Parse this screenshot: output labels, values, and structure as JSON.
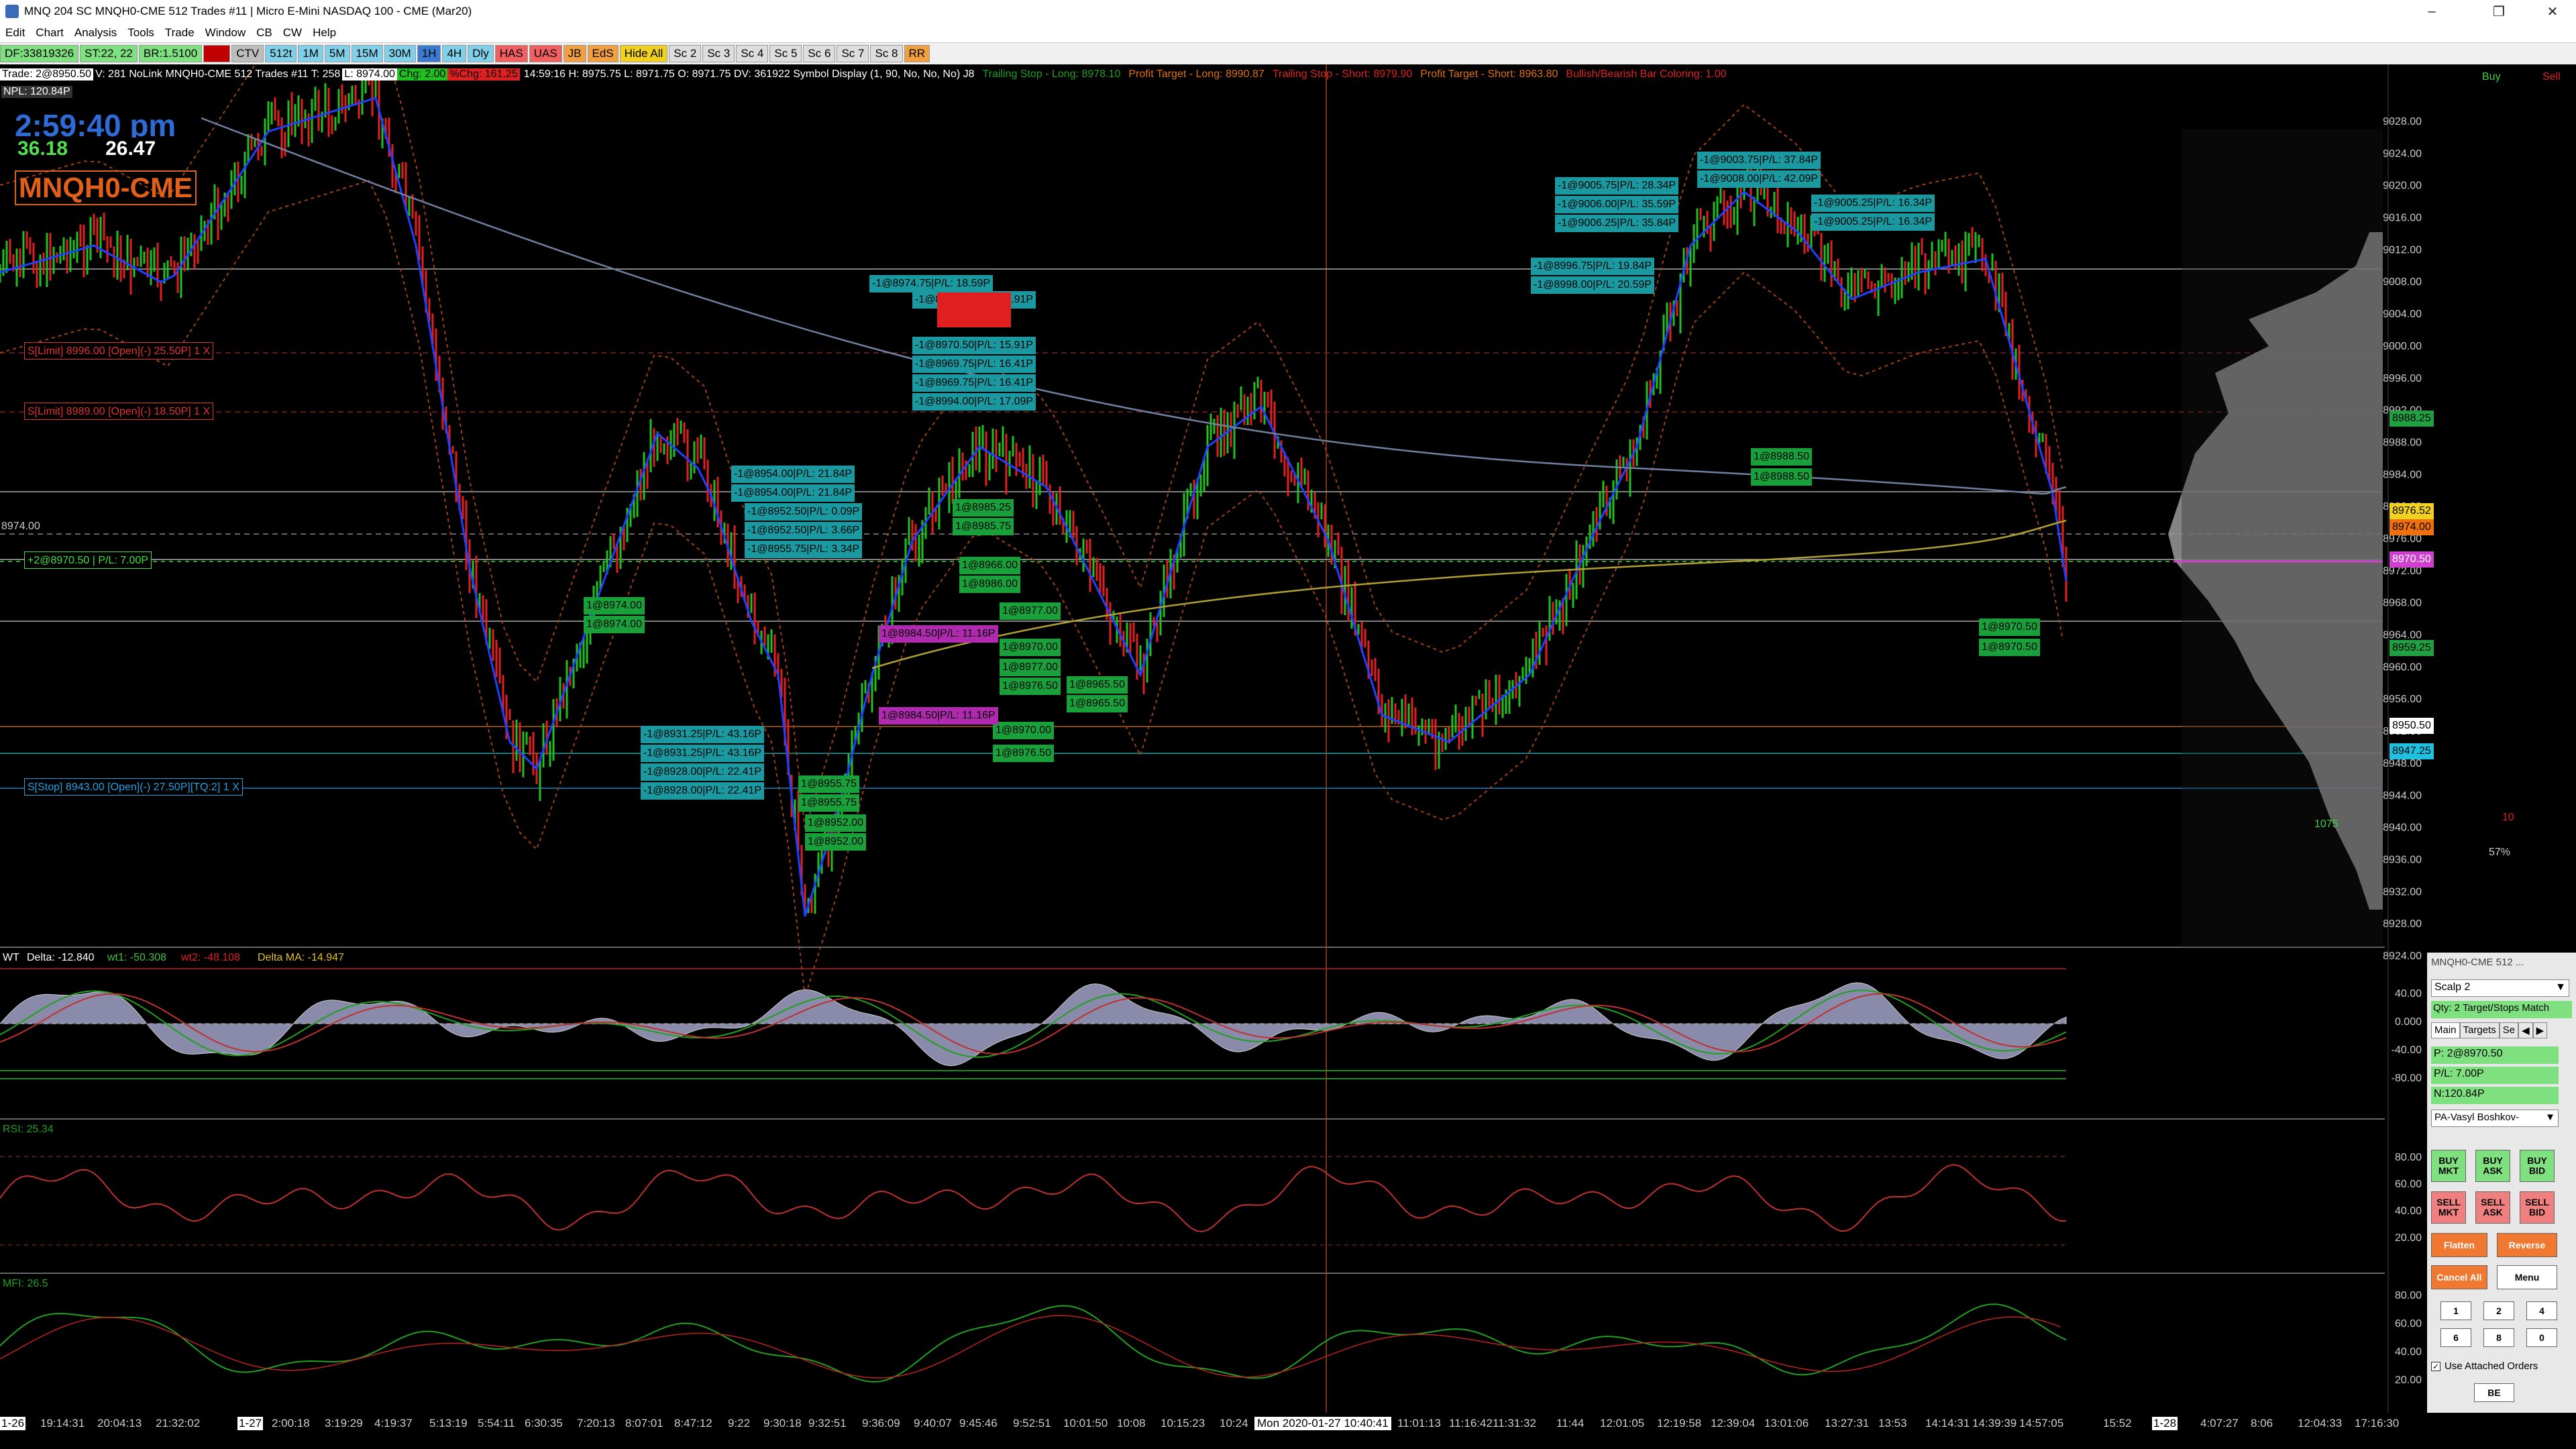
{
  "window": {
    "title": "MNQ 204  SC MNQH0-CME  512 Trades  #11 | Micro E-Mini NASDAQ 100 - CME (Mar20)"
  },
  "menu": [
    "Edit",
    "Chart",
    "Analysis",
    "Tools",
    "Trade",
    "Window",
    "CB",
    "CW",
    "Help"
  ],
  "toolbar": {
    "df": "DF:33819326",
    "st": "ST:22, 22",
    "br": "BR:1.5100",
    "tabs": [
      {
        "label": "CTV",
        "color": "#bdbdbd"
      },
      {
        "label": "512t",
        "color": "#7fd0e8"
      },
      {
        "label": "1M",
        "color": "#7fd0e8"
      },
      {
        "label": "5M",
        "color": "#7fd0e8"
      },
      {
        "label": "15M",
        "color": "#7fd0e8"
      },
      {
        "label": "30M",
        "color": "#7fd0e8"
      },
      {
        "label": "1H",
        "color": "#3a7ad0"
      },
      {
        "label": "4H",
        "color": "#7fd0e8"
      },
      {
        "label": "Dly",
        "color": "#7fd0e8"
      },
      {
        "label": "HAS",
        "color": "#f06060"
      },
      {
        "label": "UAS",
        "color": "#f06060"
      },
      {
        "label": "JB",
        "color": "#f0a040"
      },
      {
        "label": "EdS",
        "color": "#f0a040"
      },
      {
        "label": "Hide All",
        "color": "#f0d020"
      },
      {
        "label": "Sc 2",
        "color": "#ddd"
      },
      {
        "label": "Sc 3",
        "color": "#ddd"
      },
      {
        "label": "Sc 4",
        "color": "#ddd"
      },
      {
        "label": "Sc 5",
        "color": "#ddd"
      },
      {
        "label": "Sc 6",
        "color": "#ddd"
      },
      {
        "label": "Sc 7",
        "color": "#ddd"
      },
      {
        "label": "Sc 8",
        "color": "#ddd"
      },
      {
        "label": "RR",
        "color": "#f0a040"
      }
    ]
  },
  "info": {
    "trade": "Trade: 2@8950.50",
    "main": "V: 281 NoLink MNQH0-CME  512 Trades  #11  T: 258",
    "price": "L: 8974.00",
    "chg": "Chg: 2.00",
    "pct": "%Chg: 161.25",
    "tail": "14:59:16 H: 8975.75 L: 8971.75 O: 8971.75 DV: 361922 Symbol Display  (1, 90, No, No, No)  J8",
    "ts_long": "Trailing Stop - Long: 8978.10",
    "pt_long": "Profit Target - Long: 8990.87",
    "ts_short": "Trailing Stop - Short: 8979.90",
    "pt_short": "Profit Target - Short: 8963.80",
    "bb": "Bullish/Bearish Bar Coloring: 1.00"
  },
  "npl": "NPL: 120.84P",
  "clock": "2:59:40 pm",
  "num1": "36.18",
  "num2": "26.47",
  "symbol": "MNQH0-CME",
  "price_axis": [
    "9028.00",
    "9024.00",
    "9020.00",
    "9016.00",
    "9012.00",
    "9008.00",
    "9004.00",
    "9000.00",
    "8996.00",
    "8992.00",
    "8988.00",
    "8984.00",
    "8980.00",
    "8976.00",
    "8972.00",
    "8968.00",
    "8964.00",
    "8960.00",
    "8956.00",
    "8952.00",
    "8948.00",
    "8944.00",
    "8940.00",
    "8936.00",
    "8932.00",
    "8928.00",
    "8924.00"
  ],
  "price_tags": [
    {
      "text": "8976.52",
      "bg": "#f0d020",
      "fg": "#000"
    },
    {
      "text": "8974.00",
      "bg": "#f07010",
      "fg": "#000"
    },
    {
      "text": "8970.50",
      "bg": "#d040d0",
      "fg": "#fff"
    },
    {
      "text": "8950.50",
      "bg": "#fff",
      "fg": "#000"
    },
    {
      "text": "8947.25",
      "bg": "#20c0e0",
      "fg": "#000"
    },
    {
      "text": "8988.25",
      "bg": "#20a040",
      "fg": "#000"
    },
    {
      "text": "8959.25",
      "bg": "#20a040",
      "fg": "#000"
    }
  ],
  "left_tags": [
    {
      "text": "S[Limit] 8996.00 [Open](-) 25.50P] 1 X",
      "color": "#e03030"
    },
    {
      "text": "S[Limit] 8989.00 [Open](-) 18.50P] 1 X",
      "color": "#e03030"
    },
    {
      "text": "+2@8970.50 | P/L: 7.00P",
      "color": "#40e040"
    },
    {
      "text": "S[Stop] 8943.00 [Open](-) 27.50P][TQ:2] 1 X",
      "color": "#20a0e0"
    }
  ],
  "price_left": "8974.00",
  "order_tags": [
    {
      "text": "-1@8974.75|P/L: 18.59P",
      "kind": "cyan"
    },
    {
      "text": "-1@8970.50|P/L: 15.91P",
      "kind": "cyan"
    },
    {
      "text": "-1@8970.50|P/L: 15.91P",
      "kind": "cyan"
    },
    {
      "text": "-1@8969.75|P/L: 16.41P",
      "kind": "cyan"
    },
    {
      "text": "-1@8969.75|P/L: 16.41P",
      "kind": "cyan"
    },
    {
      "text": "-1@8994.00|P/L: 17.09P",
      "kind": "cyan"
    },
    {
      "text": "-1@8954.00|P/L: 21.84P",
      "kind": "cyan"
    },
    {
      "text": "-1@8954.00|P/L: 21.84P",
      "kind": "cyan"
    },
    {
      "text": "-1@8952.50|P/L: 0.09P",
      "kind": "cyan"
    },
    {
      "text": "-1@8952.50|P/L: 3.66P",
      "kind": "cyan"
    },
    {
      "text": "-1@8955.75|P/L: 3.34P",
      "kind": "cyan"
    },
    {
      "text": "-1@8931.25|P/L: 43.16P",
      "kind": "cyan"
    },
    {
      "text": "-1@8931.25|P/L: 43.16P",
      "kind": "cyan"
    },
    {
      "text": "-1@8928.00|P/L: 22.41P",
      "kind": "cyan"
    },
    {
      "text": "-1@8928.00|P/L: 22.41P",
      "kind": "cyan"
    },
    {
      "text": "-1@9005.75|P/L: 28.34P",
      "kind": "cyan"
    },
    {
      "text": "-1@9006.00|P/L: 35.59P",
      "kind": "cyan"
    },
    {
      "text": "-1@9006.25|P/L: 35.84P",
      "kind": "cyan"
    },
    {
      "text": "-1@9003.75|P/L: 37.84P",
      "kind": "cyan"
    },
    {
      "text": "-1@9008.00|P/L: 42.09P",
      "kind": "cyan"
    },
    {
      "text": "-1@9005.25|P/L: 16.34P",
      "kind": "cyan"
    },
    {
      "text": "-1@9005.25|P/L: 16.34P",
      "kind": "cyan"
    },
    {
      "text": "-1@8996.75|P/L: 19.84P",
      "kind": "cyan"
    },
    {
      "text": "-1@8998.00|P/L: 20.59P",
      "kind": "cyan"
    },
    {
      "text": "1@8974.00",
      "kind": "green"
    },
    {
      "text": "1@8974.00",
      "kind": "green"
    },
    {
      "text": "1@8985.25",
      "kind": "green"
    },
    {
      "text": "1@8985.75",
      "kind": "green"
    },
    {
      "text": "1@8966.00",
      "kind": "green"
    },
    {
      "text": "1@8986.00",
      "kind": "green"
    },
    {
      "text": "1@8977.00",
      "kind": "green"
    },
    {
      "text": "1@8970.00",
      "kind": "green"
    },
    {
      "text": "1@8977.00",
      "kind": "green"
    },
    {
      "text": "1@8976.50",
      "kind": "green"
    },
    {
      "text": "1@8965.50",
      "kind": "green"
    },
    {
      "text": "1@8965.50",
      "kind": "green"
    },
    {
      "text": "1@8970.00",
      "kind": "green"
    },
    {
      "text": "1@8976.50",
      "kind": "green"
    },
    {
      "text": "1@8955.75",
      "kind": "green"
    },
    {
      "text": "1@8955.75",
      "kind": "green"
    },
    {
      "text": "1@8952.00",
      "kind": "green"
    },
    {
      "text": "1@8952.00",
      "kind": "green"
    },
    {
      "text": "1@8988.50",
      "kind": "green"
    },
    {
      "text": "1@8988.50",
      "kind": "green"
    },
    {
      "text": "1@8970.50",
      "kind": "green"
    },
    {
      "text": "1@8970.50",
      "kind": "green"
    },
    {
      "text": "1@8984.50|P/L: 11.16P",
      "kind": "purple"
    },
    {
      "text": "1@8984.50|P/L: 11.16P",
      "kind": "purple"
    }
  ],
  "profile_vol": "1075",
  "profile_pct": "57%",
  "profile_count": "10",
  "buy": "Buy",
  "sell": "Sell",
  "wt": {
    "title": "WT",
    "delta": "Delta: -12.840",
    "wt1": "wt1: -50.308",
    "wt2": "wt2: -48.108",
    "dma": "Delta MA: -14.947",
    "axis": [
      "40.00",
      "0.000",
      "-40.00",
      "-80.00"
    ]
  },
  "rsi": {
    "title": "RSI: 25.34",
    "axis": [
      "80.00",
      "60.00",
      "40.00",
      "20.00"
    ]
  },
  "mfi": {
    "title": "MFI: 26.5",
    "axis": [
      "80.00",
      "60.00",
      "40.00",
      "20.00"
    ]
  },
  "time_axis": [
    "1-26",
    "19:14:31",
    "20:04:13",
    "21:32:02",
    "1-27",
    "2:00:18",
    "3:19:29",
    "4:19:37",
    "5:13:19",
    "5:54:11",
    "6:30:35",
    "7:20:13",
    "8:07:01",
    "8:47:12",
    "9:22",
    "9:30:18",
    "9:32:51",
    "9:36:09",
    "9:40:07",
    "9:45:46",
    "9:52:51",
    "10:01:50",
    "10:08",
    "10:15:23",
    "10:24",
    "Mon 2020-01-27 10:40:41",
    "11:01:13",
    "11:16:42",
    "11:31:32",
    "11:44",
    "12:01:05",
    "12:19:58",
    "12:39:04",
    "13:01:06",
    "13:27:31",
    "13:53",
    "14:14:31",
    "14:39:39",
    "14:57:05",
    "15:52",
    "1-28",
    "4:07:27",
    "8:06",
    "12:04:33",
    "17:16:30"
  ],
  "trade_panel": {
    "title": "MNQH0-CME  512 ...",
    "preset": "Scalp 2",
    "match": "Qty: 2 Target/Stops Match",
    "tabs": [
      "Main",
      "Targets",
      "Se"
    ],
    "pos": "P: 2@8970.50",
    "pl": "P/L: 7.00P",
    "npl": "N:120.84P",
    "account": "PA-Vasyl Boshkov-",
    "buy_mkt": "BUY MKT",
    "buy_ask": "BUY ASK",
    "buy_bid": "BUY BID",
    "sell_mkt": "SELL MKT",
    "sell_ask": "SELL ASK",
    "sell_bid": "SELL BID",
    "flatten": "Flatten",
    "reverse": "Reverse",
    "cancel_all": "Cancel All",
    "menu": "Menu",
    "qty_buttons": [
      "1",
      "2",
      "4",
      "6",
      "8",
      "0"
    ],
    "use_attached": "Use Attached Orders",
    "be": "BE"
  }
}
